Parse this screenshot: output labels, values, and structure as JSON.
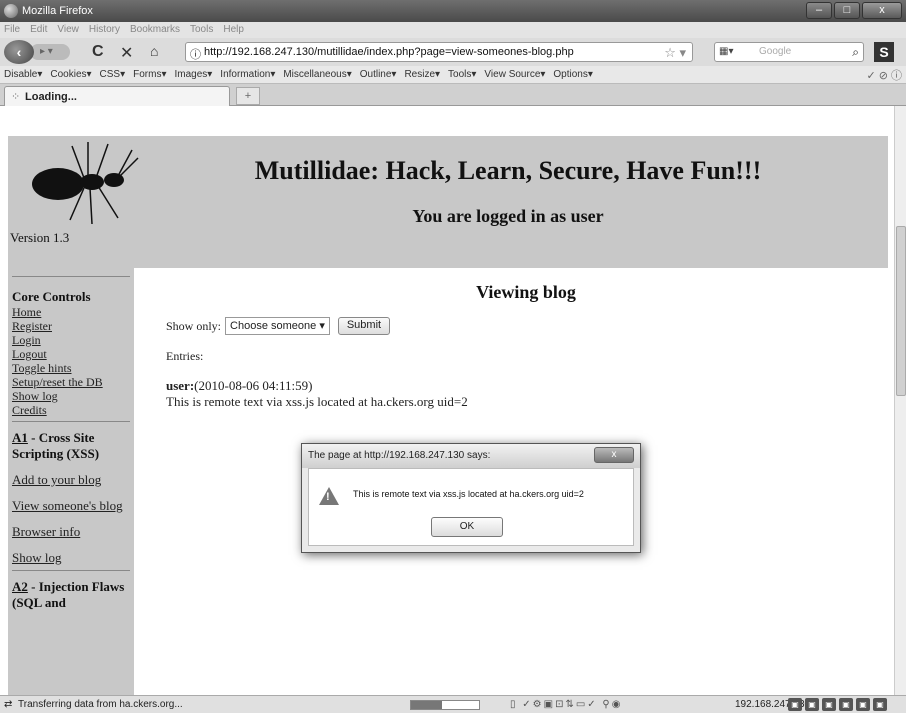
{
  "window": {
    "title": "Mozilla Firefox",
    "min_label": "–",
    "max_label": "□",
    "close_label": "x"
  },
  "menu": [
    "File",
    "Edit",
    "View",
    "History",
    "Bookmarks",
    "Tools",
    "Help"
  ],
  "nav": {
    "url": "http://192.168.247.130/mutillidae/index.php?page=view-someones-blog.php",
    "search_engine": "Google",
    "search_placeholder": ""
  },
  "devbar": [
    "Disable▾",
    "Cookies▾",
    "CSS▾",
    "Forms▾",
    "Images▾",
    "Information▾",
    "Miscellaneous▾",
    "Outline▾",
    "Resize▾",
    "Tools▾",
    "View Source▾",
    "Options▾"
  ],
  "tab": {
    "label": "Loading...",
    "new_tab": "+"
  },
  "page": {
    "version": "Version 1.3",
    "site_title": "Mutillidae: Hack, Learn, Secure, Have Fun!!!",
    "logged_in": "You are logged in as user",
    "sidebar": {
      "core_heading": "Core Controls",
      "core_links": [
        "Home",
        "Register",
        "Login",
        "Logout",
        "Toggle hints",
        "Setup/reset the DB",
        "Show log",
        "Credits"
      ],
      "a1_prefix": "A1",
      "a1_title": " - Cross Site Scripting (XSS)",
      "a1_links": [
        "Add to your blog",
        "View someone's blog",
        "Browser info",
        "Show log"
      ],
      "a2_prefix": "A2",
      "a2_title": " - Injection Flaws (SQL and"
    },
    "main": {
      "heading": "Viewing blog",
      "show_only_label": "Show only:",
      "select_value": "Choose someone",
      "submit_label": "Submit",
      "entries_label": "Entries:",
      "entry_user": "user:",
      "entry_time": "(2010-08-06 04:11:59)",
      "entry_text": "This is remote text via xss.js located at ha.ckers.org uid=2"
    }
  },
  "dialog": {
    "title": "The page at http://192.168.247.130 says:",
    "message": "This is remote text via xss.js located at ha.ckers.org uid=2",
    "ok_label": "OK",
    "close_label": "x"
  },
  "status": {
    "text": "Transferring data from ha.ckers.org...",
    "ip": "192.168.247.130"
  }
}
